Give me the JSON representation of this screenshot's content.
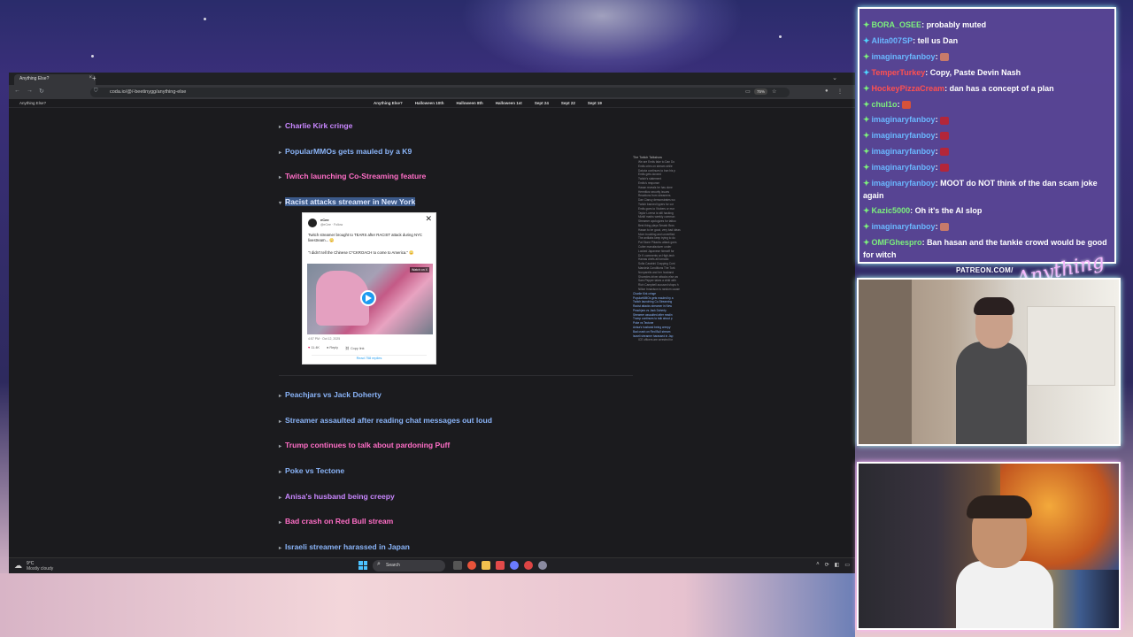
{
  "browser": {
    "tab_title": "Anything Else?",
    "tab_close": "×",
    "new_tab": "+",
    "tab_list": "⌄",
    "back": "←",
    "forward": "→",
    "reload": "↻",
    "url": "coda.io/@/-beetinygg/anything-else",
    "zoom": "75%"
  },
  "site": {
    "name": "Anything Else?",
    "nav": [
      "Anything Else?",
      "Halloween 10th",
      "Halloween 8th",
      "Halloween 1st",
      "Sept 24",
      "Sept 22",
      "Sept 19"
    ]
  },
  "topics": [
    {
      "label": "Charlie Kirk cringe",
      "color": "purple",
      "caret": "▸"
    },
    {
      "label": "PopularMMOs gets mauled by a K9",
      "color": "blue",
      "caret": "▸"
    },
    {
      "label": "Twitch launching Co-Streaming feature",
      "color": "pink",
      "caret": "▸"
    },
    {
      "label": "Racist attacks streamer in New York",
      "color": "selected",
      "caret": "▾"
    },
    {
      "label": "Peachjars vs Jack Doherty",
      "color": "blue",
      "caret": "▸"
    },
    {
      "label": "Streamer assaulted after reading chat messages out loud",
      "color": "purple",
      "caret": "▸"
    },
    {
      "label": "Trump continues to talk about pardoning Puff",
      "color": "pink",
      "caret": "▸"
    },
    {
      "label": "Poke vs Tectone",
      "color": "blue",
      "caret": "▸"
    },
    {
      "label": "Anisa's husband being creepy",
      "color": "purple",
      "caret": "▸"
    },
    {
      "label": "Bad crash on Red Bull stream",
      "color": "pink",
      "caret": "▸"
    },
    {
      "label": "Israeli streamer harassed in Japan",
      "color": "blue",
      "caret": "▸"
    }
  ],
  "tweet": {
    "name": "eCee",
    "handle": "@eCee · Follow",
    "text": "Twitch streamer brought to TEARS after RACIST attack during NYC livestream... 😳",
    "quote": "\"I didn't tell the Chinese C*CKROACH to come to America.\" 😳",
    "watch_label": "Watch on X",
    "time": "4:57 PM · Oct 12, 2025",
    "likes": "11.4K",
    "reply": "Reply",
    "copy": "Copy link",
    "read_replies": "Read 758 replies"
  },
  "toc": {
    "title": "The Twitch Talkshow",
    "items": [
      "We are Emils fake to Dan Do",
      "Emils cries on stream while",
      "Dakota continues to ban his p",
      "Emils gets doxxed",
      "Twitch's statement",
      "Emils's response",
      "Hasan reveals he has done",
      "Hermitics security issues",
      "Reactions from streamers",
      "Dan Clancy demonstrates wo",
      "Twitch banned typers for cor",
      "Emils goes to Vtubers or mor",
      "Taylor Lorenz is still hacking",
      "Mizkif marks weekly commun",
      "Streamer apologizes for tattoo",
      "Best thing plays Smash Bros",
      "Hasan to be good, very bad ideas",
      "More troubling and unverified",
      "The antilabs keep trying to do",
      "Pat Stone Pikachu attack goes",
      "Cutter manufacturer under",
      "Locked Japanese himself for",
      "Dr K comments on High-tech",
      "Hamas chefs all tornado",
      "Sofia Carabini Crapping Cont",
      "Mandela Conditions The Turk",
      "Nonpareils and her husband",
      "Shuredes driver attacks else wo",
      "Sam Pepper takes a child with",
      "Rich Campbell accused shops h",
      "Nilton Innavison is random cause",
      "Charlie Kirk cringe",
      "PopularMMOs gets mauled by a",
      "Twitch launching Co-Streaming",
      "Racist attacks streamer in New",
      "Peachjars vs Jack Doherty",
      "Streamer assaulted after readin",
      "Trump continues to talk about p",
      "Poke vs Tectone",
      "Anisa's husband being creepy",
      "Bad crash on Red Bull stream",
      "Israeli streamer harassed in Jap",
      "ICE officers are arrested for"
    ]
  },
  "taskbar": {
    "temp": "9°C",
    "weather": "Mostly cloudy",
    "search": "Search"
  },
  "chat": [
    {
      "user": "BORA_OSEE",
      "ucolor": "green",
      "text": "probably muted",
      "badge": "gem"
    },
    {
      "user": "Alita007SP",
      "ucolor": "blue",
      "text": "tell us Dan",
      "badge": "gem2"
    },
    {
      "user": "imaginaryfanboy",
      "ucolor": "blue",
      "text": "",
      "badge": "gem",
      "emote": "#c87a6a"
    },
    {
      "user": "TemperTurkey",
      "ucolor": "red",
      "text": "Copy, Paste Devin Nash",
      "badge": "gem2"
    },
    {
      "user": "HockeyPizzaCream",
      "ucolor": "red",
      "text": "dan has a concept of a plan",
      "badge": "gem"
    },
    {
      "user": "chul1o",
      "ucolor": "green",
      "text": "",
      "badge": "gem",
      "emote": "#d6523a"
    },
    {
      "user": "imaginaryfanboy",
      "ucolor": "blue",
      "text": "",
      "badge": "gem",
      "emote": "#b3263a"
    },
    {
      "user": "imaginaryfanboy",
      "ucolor": "blue",
      "text": "",
      "badge": "gem",
      "emote": "#b3263a"
    },
    {
      "user": "imaginaryfanboy",
      "ucolor": "blue",
      "text": "",
      "badge": "gem",
      "emote": "#b3263a"
    },
    {
      "user": "imaginaryfanboy",
      "ucolor": "blue",
      "text": "",
      "badge": "gem",
      "emote": "#b3263a"
    },
    {
      "user": "imaginaryfanboy",
      "ucolor": "blue",
      "text": "MOOT do NOT think of the dan scam joke again",
      "badge": "gem"
    },
    {
      "user": "Kazic5000",
      "ucolor": "green",
      "text": "Oh it's the AI slop",
      "badge": "gem"
    },
    {
      "user": "imaginaryfanboy",
      "ucolor": "blue",
      "text": "",
      "badge": "gem",
      "emote": "#c87a6a"
    },
    {
      "user": "OMFGhespro",
      "ucolor": "green",
      "text": "Ban hasan and the tankie crowd would be good for witch",
      "badge": "gem"
    }
  ],
  "overlay": {
    "patreon": "PATREON.COM/",
    "logo": "Anything Else?"
  },
  "colors": {
    "purple": "#c987ff",
    "blue": "#8ab4f8",
    "pink": "#ff6ec7"
  }
}
